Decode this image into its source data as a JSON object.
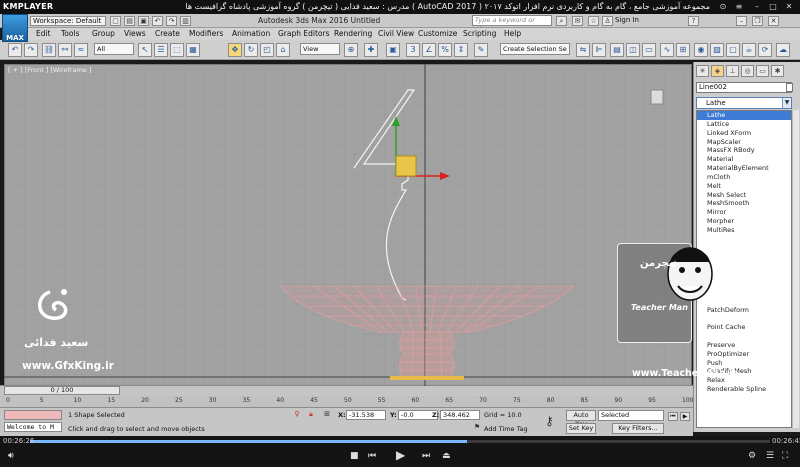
{
  "kmplayer": {
    "brand": "KMPLAYER",
    "title": "مجموعه آموزشی جامع ، گام به گام و کاربردی نرم افزار اتوکد ۲۰۱۷ ( AutoCAD 2017 ) مدرس : سعید فدایی ( تیچرمن ) گروه آموزشی پادشاه گرافیست ها",
    "time_current": "00:26:26",
    "time_total": "00:26:45",
    "progress": 0.59
  },
  "max": {
    "logo": "MAX",
    "workspace": "Workspace: Default",
    "title": "Autodesk 3ds Max 2016    Untitled",
    "search_placeholder": "Type a keyword or phrase",
    "signin": "Sign In",
    "menus": [
      "Edit",
      "Tools",
      "Group",
      "Views",
      "Create",
      "Modifiers",
      "Animation",
      "Graph Editors",
      "Rendering",
      "Civil View",
      "Customize",
      "Scripting",
      "Help"
    ],
    "toolbar": {
      "filter": "All",
      "ref_coord": "View",
      "selection_set_placeholder": "Create Selection Se"
    },
    "viewport_label": "[ + ] [Front ] [Wireframe ]"
  },
  "command_panel": {
    "object_name": "Line002",
    "modifier_dropdown": "Lathe",
    "modifiers": [
      "Lathe",
      "Lattice",
      "Linked XForm",
      "MapScaler",
      "MassFX RBody",
      "Material",
      "MaterialByElement",
      "mCloth",
      "Melt",
      "Mesh Select",
      "MeshSmooth",
      "Mirror",
      "Morpher",
      "MultiRes",
      "",
      "",
      "",
      "",
      "",
      "",
      "",
      "",
      "PatchDeform",
      "",
      "Point Cache",
      "",
      "Preserve",
      "ProOptimizer",
      "Push",
      "Quadify Mesh",
      "Relax",
      "Renderable Spline"
    ],
    "selected_index": 0
  },
  "timeline": {
    "slider": "0 / 100",
    "ticks": [
      "0",
      "5",
      "10",
      "15",
      "20",
      "25",
      "30",
      "35",
      "40",
      "45",
      "50",
      "55",
      "60",
      "65",
      "70",
      "75",
      "80",
      "85",
      "90",
      "95",
      "100"
    ]
  },
  "status": {
    "listener": "Welcome to M",
    "selection": "1 Shape Selected",
    "prompt": "Click and drag to select and move objects",
    "x_label": "X:",
    "x": "-31.538",
    "y_label": "Y:",
    "y": "-0.0",
    "z_label": "Z:",
    "z": "348.462",
    "grid": "Grid = 10.0",
    "add_time_tag": "Add Time Tag",
    "auto_key": "Auto Key",
    "set_key": "Set Key",
    "key_mode": "Selected",
    "key_filters": "Key Filters..."
  },
  "watermark": {
    "teacher_fa": "تیچرمن",
    "teacher_name": "Teacher Man",
    "teacher_url": "www.TeacherMan.ir",
    "gfx_fa": "سعید فدائی",
    "gfx_url": "www.GfxKing.ir"
  },
  "colors": {
    "accent": "#3e7bd4",
    "lathe_mesh": "#f0a0a0",
    "active_tool": "#f6d77a"
  }
}
